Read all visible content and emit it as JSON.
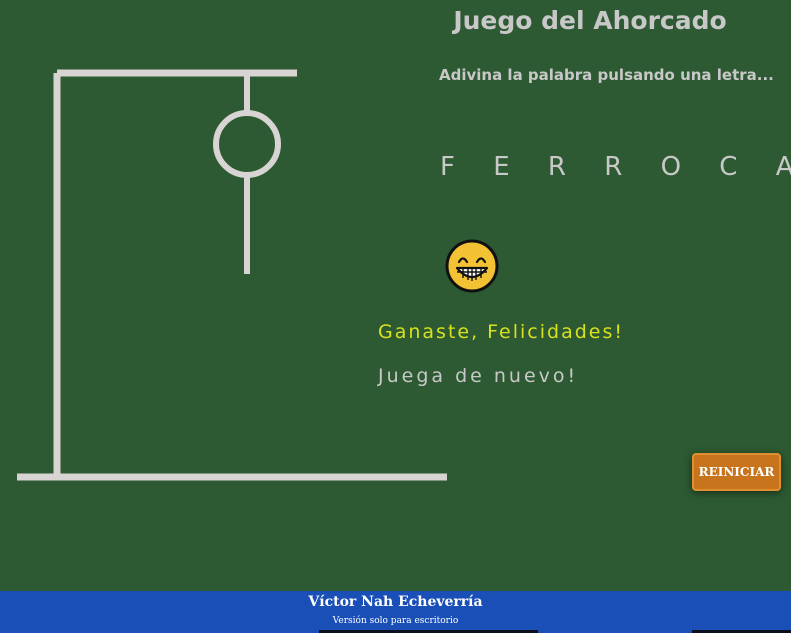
{
  "game": {
    "title": "Juego del Ahorcado",
    "instruction": "Adivina la palabra pulsando una letra...",
    "word_display": "F E R R O C A R R I L",
    "result_message": "Ganaste, Felicidades!",
    "play_again": "Juega de nuevo!",
    "reset_label": "REINICIAR",
    "result_icon": "grinning-face-icon",
    "drawn_parts": [
      "head",
      "body"
    ]
  },
  "footer": {
    "author": "Víctor Nah Echeverría",
    "note": "Versión solo para escritorio"
  },
  "colors": {
    "background": "#2d5a32",
    "text": "#c8c8c8",
    "gallows": "#d9d4d4",
    "win_text": "#d8e11e",
    "button": "#c8741c",
    "footer": "#1a4fb8"
  }
}
